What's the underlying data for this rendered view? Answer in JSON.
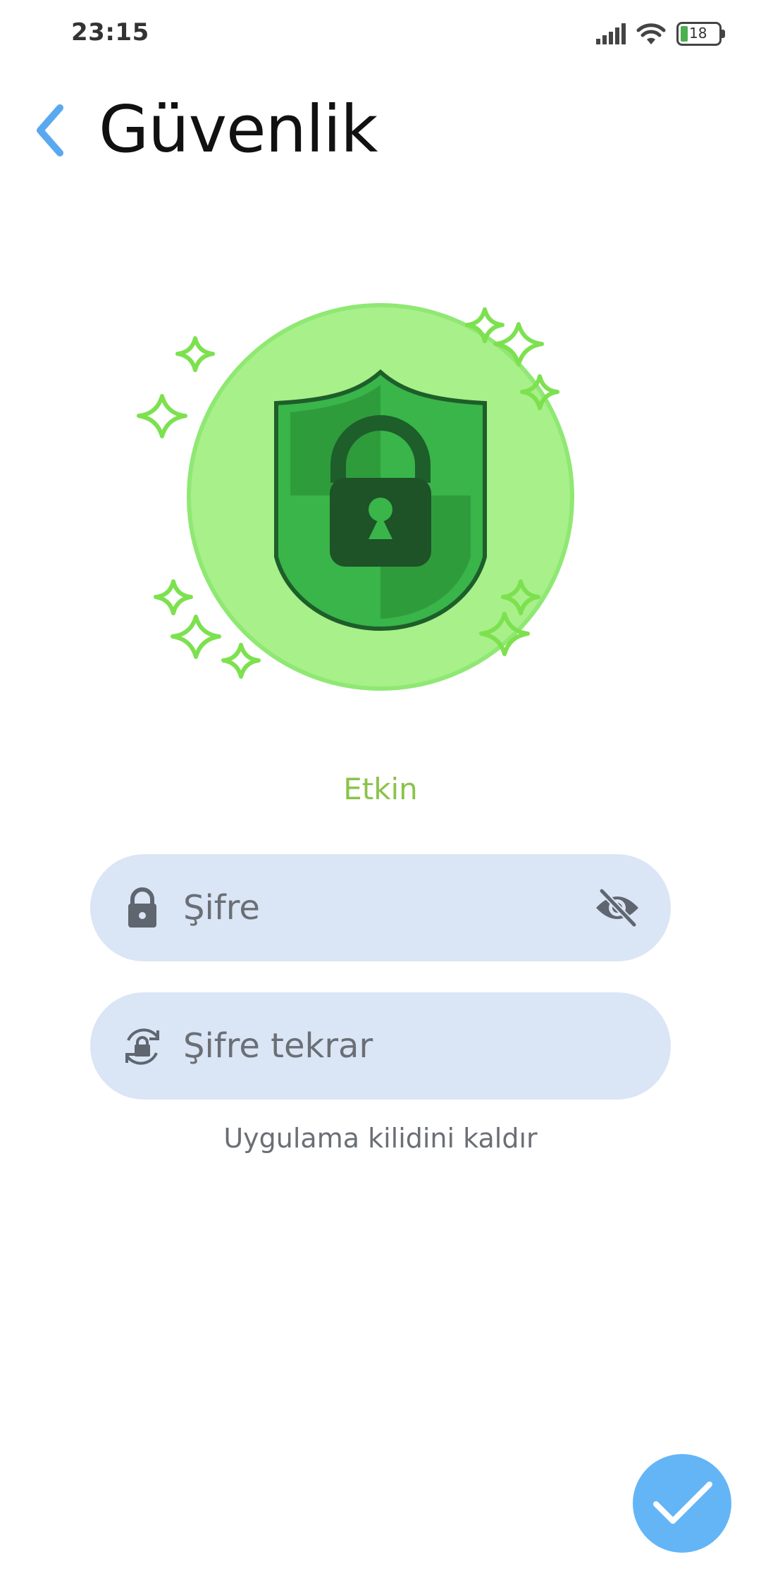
{
  "status_bar": {
    "time": "23:15",
    "battery_level": "18",
    "icons": [
      "signal-icon",
      "wifi-icon",
      "battery-icon"
    ]
  },
  "header": {
    "title": "Güvenlik",
    "back_icon": "chevron-left-icon"
  },
  "hero": {
    "icon": "shield-lock-icon",
    "status_label": "Etkin"
  },
  "form": {
    "password": {
      "placeholder": "Şifre",
      "value": "",
      "icon": "lock-icon",
      "toggle_icon": "eye-off-icon"
    },
    "password_repeat": {
      "placeholder": "Şifre tekrar",
      "value": "",
      "icon": "lock-refresh-icon"
    }
  },
  "actions": {
    "remove_lock_label": "Uygulama kilidini kaldır",
    "confirm_icon": "check-icon"
  },
  "colors": {
    "accent": "#64b5f6",
    "active": "#8bc34a",
    "field_bg": "#dae5f5",
    "shield_green": "#39b54a",
    "circle_green": "#a8f08a"
  }
}
